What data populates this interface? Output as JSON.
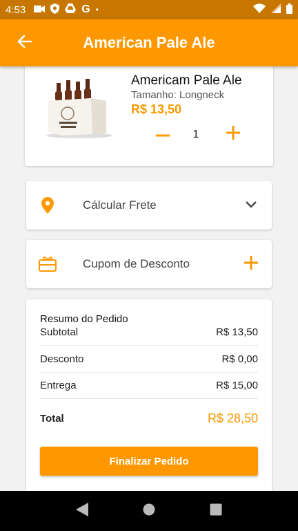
{
  "status_bar": {
    "time": "4:53"
  },
  "app_bar": {
    "title": "American Pale Ale"
  },
  "product": {
    "name": "Americam Pale Ale",
    "size": "Tamanho: Longneck",
    "price": "R$ 13,50",
    "quantity": "1"
  },
  "options": {
    "frete_label": "Cálcular Frete",
    "cupom_label": "Cupom de Desconto"
  },
  "summary": {
    "title": "Resumo do Pedido",
    "rows": [
      {
        "label": "Subtotal",
        "value": "R$ 13,50"
      },
      {
        "label": "Desconto",
        "value": "R$ 0,00"
      },
      {
        "label": "Entrega",
        "value": "R$ 15,00"
      }
    ],
    "total_label": "Total",
    "total_value": "R$ 28,50",
    "button_label": "Finalizar Pedido"
  },
  "colors": {
    "accent": "#ff9800",
    "status_bar": "#c77700"
  }
}
